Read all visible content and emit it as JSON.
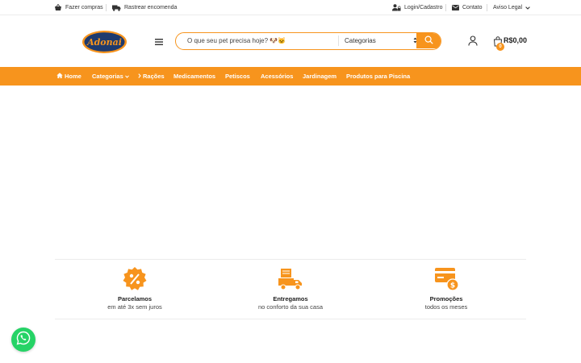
{
  "topbar": {
    "left_links": [
      {
        "label": "Fazer compras",
        "icon": "basket-icon"
      },
      {
        "label": "Rastrear encomenda",
        "icon": "truck-icon"
      }
    ],
    "right_links": [
      {
        "label": "Login/Cadastro",
        "icon": "user-lock-icon"
      },
      {
        "label": "Contato",
        "icon": "envelope-icon"
      },
      {
        "label": "Aviso Legal",
        "icon": "chevron-down-icon"
      }
    ]
  },
  "header": {
    "logo_text": "Adonai",
    "search": {
      "placeholder": "O que seu pet precisa hoje? 🐶🐱",
      "category_label": "Categorias"
    },
    "cart": {
      "count": "0",
      "total": "R$0,00"
    }
  },
  "nav": {
    "items": [
      {
        "label": "Home",
        "icon": "home-icon"
      },
      {
        "label": "Categorias",
        "icon": "chevron-down-icon"
      },
      {
        "label": "Rações",
        "icon": "chevron-right-icon"
      },
      {
        "label": "Medicamentos"
      },
      {
        "label": "Petiscos"
      },
      {
        "label": "Acessórios"
      },
      {
        "label": "Jardinagem"
      },
      {
        "label": "Produtos para Piscina"
      }
    ]
  },
  "features": [
    {
      "title": "Parcelamos",
      "subtitle": "em até 3x sem juros",
      "icon": "percent-badge-icon"
    },
    {
      "title": "Entregamos",
      "subtitle": "no conforto da sua casa",
      "icon": "delivery-truck-icon"
    },
    {
      "title": "Promoções",
      "subtitle": "todos os meses",
      "icon": "card-dollar-icon"
    }
  ],
  "colors": {
    "accent": "#f7941d",
    "whatsapp": "#25d366",
    "logo_bg": "#1e3a6e"
  }
}
